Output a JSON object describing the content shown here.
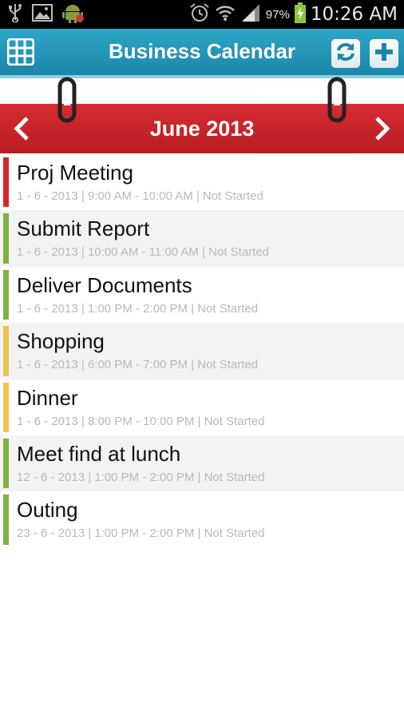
{
  "status_bar": {
    "battery_percent": "97%",
    "time": "10:26 AM",
    "icons": [
      "usb-icon",
      "image-icon",
      "android-icon",
      "alarm-icon",
      "wifi-icon",
      "signal-icon",
      "battery-icon"
    ]
  },
  "action_bar": {
    "title": "Business Calendar",
    "left_button": "grid-icon",
    "right_buttons": [
      "sync-icon",
      "add-icon"
    ],
    "color": "#1e8fb1"
  },
  "month_bar": {
    "label": "June 2013",
    "prev": "chevron-left-icon",
    "next": "chevron-right-icon",
    "color": "#c42127"
  },
  "events": [
    {
      "title": "Proj Meeting",
      "detail": "1 - 6 - 2013 | 9:00 AM - 10:00 AM | Not Started",
      "color": "#d7262c"
    },
    {
      "title": "Submit Report",
      "detail": "1 - 6 - 2013 | 10:00 AM - 11:00 AM | Not Started",
      "color": "#7cb342"
    },
    {
      "title": "Deliver Documents",
      "detail": "1 - 6 - 2013 | 1:00 PM - 2:00 PM | Not Started",
      "color": "#7cb342"
    },
    {
      "title": "Shopping",
      "detail": "1 - 6 - 2013 | 6:00 PM - 7:00 PM | Not Started",
      "color": "#f1c24a"
    },
    {
      "title": "Dinner",
      "detail": "1 - 6 - 2013 | 8:00 PM - 10:00 PM | Not Started",
      "color": "#f1c24a"
    },
    {
      "title": "Meet find at lunch",
      "detail": "12 - 6 - 2013 | 1:00 PM - 2:00 PM | Not Started",
      "color": "#7cb342"
    },
    {
      "title": "Outing",
      "detail": "23 - 6 - 2013 | 1:00 PM - 2:00 PM | Not Started",
      "color": "#7cb342"
    }
  ]
}
